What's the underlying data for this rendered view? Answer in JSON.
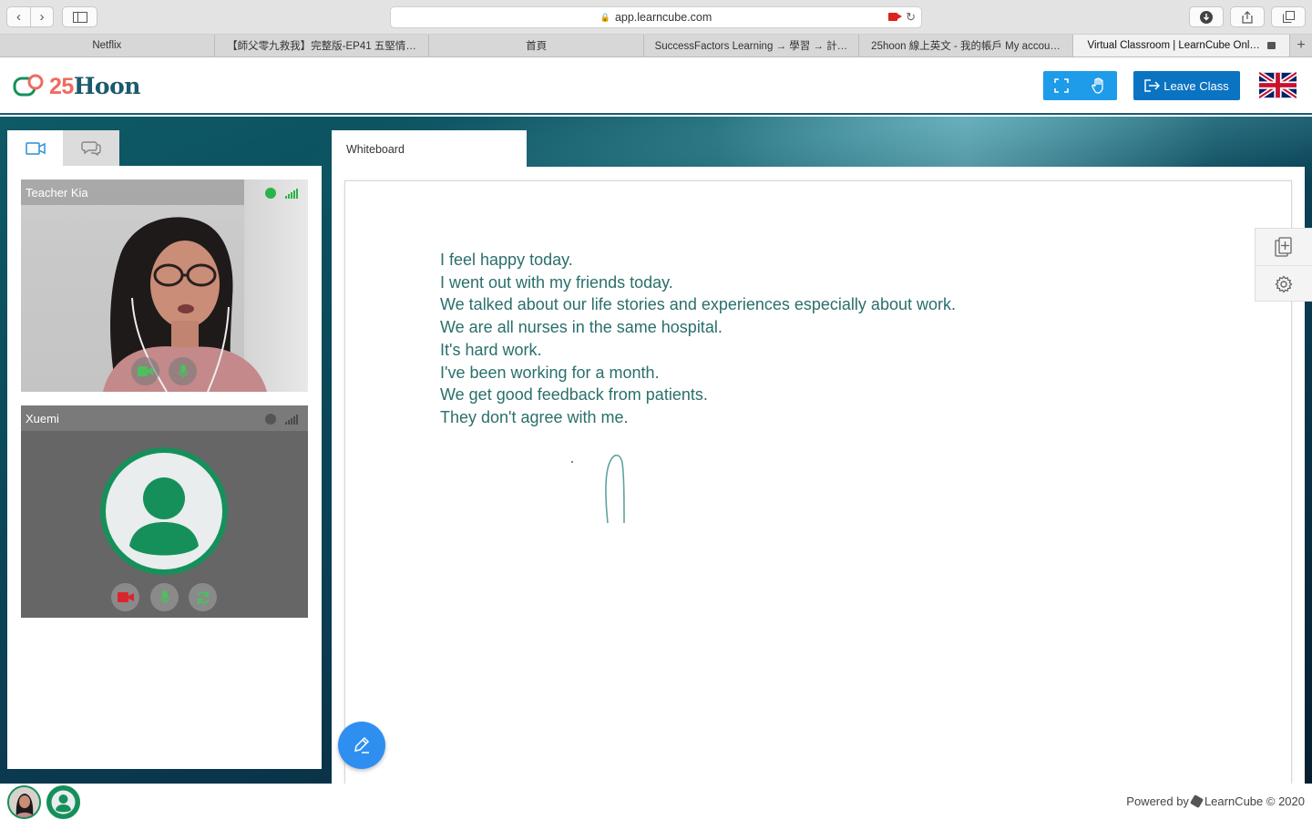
{
  "browser": {
    "url": "app.learncube.com",
    "tabs": [
      {
        "label": "Netflix",
        "active": false
      },
      {
        "label": "【師父零九救我】完整版-EP41 五堅情…",
        "active": false
      },
      {
        "label": "首頁",
        "active": false
      },
      {
        "label": "SuccessFactors Learning → 學習 → 計…",
        "active": false
      },
      {
        "label": "25hoon 線上英文 - 我的帳戶 My accou…",
        "active": false
      },
      {
        "label": "Virtual Classroom | LearnCube Onl…",
        "active": true
      }
    ],
    "new_tab_symbol": "+"
  },
  "header": {
    "logo_number": "25",
    "logo_word": "Hoon",
    "leave_label": "Leave Class",
    "fullscreen_icon": "fullscreen-icon",
    "hand_icon": "raise-hand-icon",
    "language_flag": "uk-flag-icon",
    "brand_color": "#1c5a6e",
    "accent_color": "#ef6b5f"
  },
  "left_panel": {
    "tabs": [
      {
        "icon": "video-camera-icon",
        "active": true
      },
      {
        "icon": "chat-icon",
        "active": false
      }
    ],
    "participants": [
      {
        "name": "Teacher Kia",
        "status_color": "#2bb34a",
        "online": true
      },
      {
        "name": "Xuemi",
        "status_color": "#555555",
        "online": false
      }
    ]
  },
  "whiteboard": {
    "tab_label": "Whiteboard",
    "text_color": "#2a6f6b",
    "lines": [
      "I feel happy today.",
      "I went out with my friends today.",
      "We talked about our life stories and experiences especially about work.",
      "We are all nurses in the same hospital.",
      "It's hard work.",
      "I've been working for a month.",
      "We get good feedback from patients.",
      "They don't agree with me."
    ],
    "tools": [
      "add-page-icon",
      "settings-icon"
    ],
    "pen_button_icon": "pen-icon"
  },
  "footer": {
    "powered_prefix": "Powered by",
    "powered_brand": "LearnCube © 2020"
  }
}
